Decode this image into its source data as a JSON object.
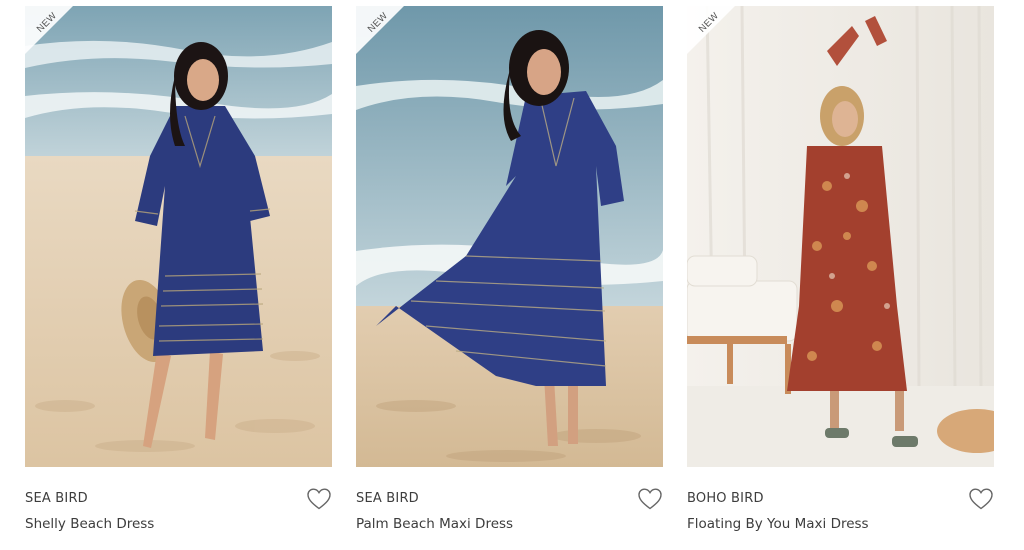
{
  "products": [
    {
      "badge": "NEW",
      "brand": "SEA BIRD",
      "name": "Shelly Beach Dress",
      "wishlist_icon": "heart-outline-icon"
    },
    {
      "badge": "NEW",
      "brand": "SEA BIRD",
      "name": "Palm Beach Maxi Dress",
      "wishlist_icon": "heart-outline-icon"
    },
    {
      "badge": "NEW",
      "brand": "BOHO BIRD",
      "name": "Floating By You Maxi Dress",
      "wishlist_icon": "heart-outline-icon"
    }
  ],
  "colors": {
    "text": "#3d3d3d",
    "navy_dress": "#2a3a7a",
    "rust_dress": "#a0402f",
    "sand": "#e6d3b8",
    "sea": "#8fb2c2"
  }
}
